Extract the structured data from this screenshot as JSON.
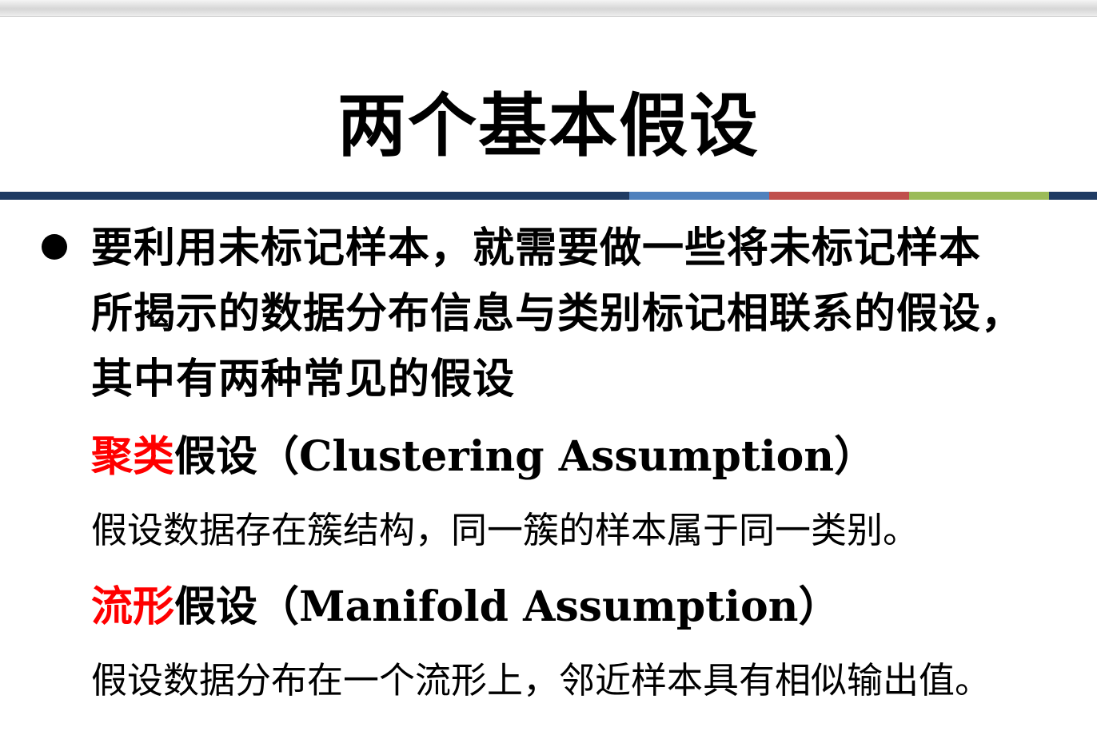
{
  "title": "两个基本假设",
  "colors": {
    "accent_red": "#ff0000",
    "bar_navy": "#1f3b63",
    "bar_blue": "#4f81bd",
    "bar_red": "#c0504d",
    "bar_green": "#9bbb59"
  },
  "bullet": {
    "icon": "filled-circle-bullet",
    "lines": [
      "要利用未标记样本，就需要做一些将未标记样本",
      "所揭示的数据分布信息与类别标记相联系的假设，",
      "其中有两种常见的假设"
    ]
  },
  "assumptions": [
    {
      "term": "聚类",
      "suffix": "假设（Clustering Assumption）",
      "description": "假设数据存在簇结构，同一簇的样本属于同一类别。"
    },
    {
      "term": "流形",
      "suffix": "假设（Manifold Assumption）",
      "description": "假设数据分布在一个流形上，邻近样本具有相似输出值。"
    }
  ]
}
